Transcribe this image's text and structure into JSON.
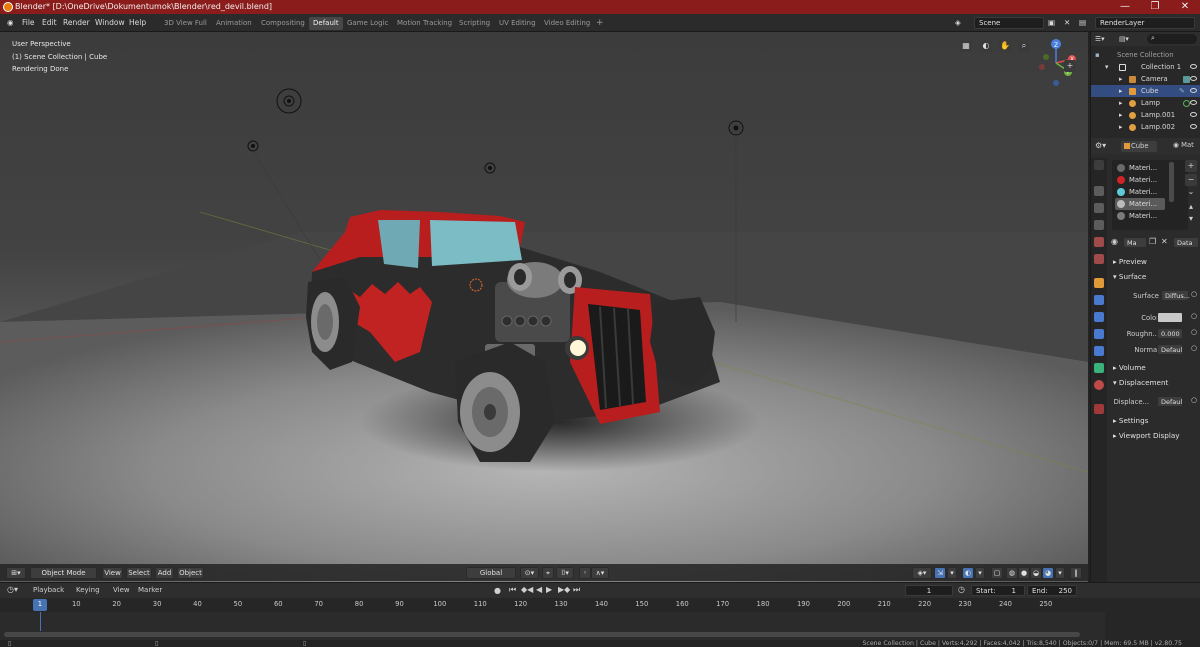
{
  "window": {
    "title": "Blender* [D:\\OneDrive\\Dokumentumok\\Blender\\red_devil.blend]",
    "minimize": "—",
    "maximize": "❐",
    "close": "✕"
  },
  "menu": {
    "items": [
      "File",
      "Edit",
      "Render",
      "Window",
      "Help"
    ],
    "workspaces": [
      "3D View Full",
      "Animation",
      "Compositing",
      "Default",
      "Game Logic",
      "Motion Tracking",
      "Scripting",
      "UV Editing",
      "Video Editing"
    ],
    "active_workspace": "Default",
    "add_workspace": "+",
    "scene": "Scene",
    "render_layer": "RenderLayer"
  },
  "viewport": {
    "info": [
      "User Perspective",
      "(1) Scene Collection | Cube",
      "Rendering Done"
    ],
    "header": {
      "mode": "Object Mode",
      "menus": [
        "View",
        "Select",
        "Add",
        "Object"
      ],
      "orientation": "Global"
    },
    "gizmo_axes": {
      "x": "X",
      "y": "Y",
      "z": "Z"
    }
  },
  "outliner": {
    "root": "Scene Collection",
    "items": [
      {
        "label": "Collection 1",
        "type": "collection"
      },
      {
        "label": "Camera",
        "type": "camera"
      },
      {
        "label": "Cube",
        "type": "mesh"
      },
      {
        "label": "Lamp",
        "type": "lamp"
      },
      {
        "label": "Lamp.001",
        "type": "lamp"
      },
      {
        "label": "Lamp.002",
        "type": "lamp"
      }
    ]
  },
  "properties": {
    "object_name": "Cube",
    "context_label": "Mat",
    "materials": [
      {
        "label": "Materi...",
        "color": "#6a6a6a"
      },
      {
        "label": "Materi...",
        "color": "#d02424"
      },
      {
        "label": "Materi...",
        "color": "#5ec9d8"
      },
      {
        "label": "Materi...",
        "color": "#bbbbbb"
      },
      {
        "label": "Materi...",
        "color": "#7a7a7a"
      }
    ],
    "mat_field": "Ma",
    "data_field": "Data",
    "sections": {
      "preview": "Preview",
      "surface": "Surface",
      "volume": "Volume",
      "displacement": "Displacement",
      "settings": "Settings",
      "viewport_display": "Viewport Display"
    },
    "surface_label": "Surface",
    "surface_value": "Diffus...",
    "color_label": "Color",
    "color_value": "#c9c9c9",
    "roughness_label": "Roughn...",
    "roughness_value": "0.000",
    "normal_label": "Normal",
    "normal_value": "Defaul",
    "displace_label": "Displace...",
    "displace_value": "Defaul"
  },
  "timeline": {
    "menus": [
      "Playback",
      "Keying",
      "View",
      "Marker"
    ],
    "current_frame": "1",
    "start_label": "Start:",
    "start": "1",
    "end_label": "End:",
    "end": "250",
    "ticks": [
      "1",
      "10",
      "20",
      "30",
      "40",
      "50",
      "60",
      "70",
      "80",
      "90",
      "100",
      "110",
      "120",
      "130",
      "140",
      "150",
      "160",
      "170",
      "180",
      "190",
      "200",
      "210",
      "220",
      "230",
      "240",
      "250"
    ]
  },
  "status": "Scene Collection | Cube | Verts:4,292 | Faces:4,042 | Tris:8,540 | Objects:0/7 | Mem: 69.5 MB | v2.80.75"
}
